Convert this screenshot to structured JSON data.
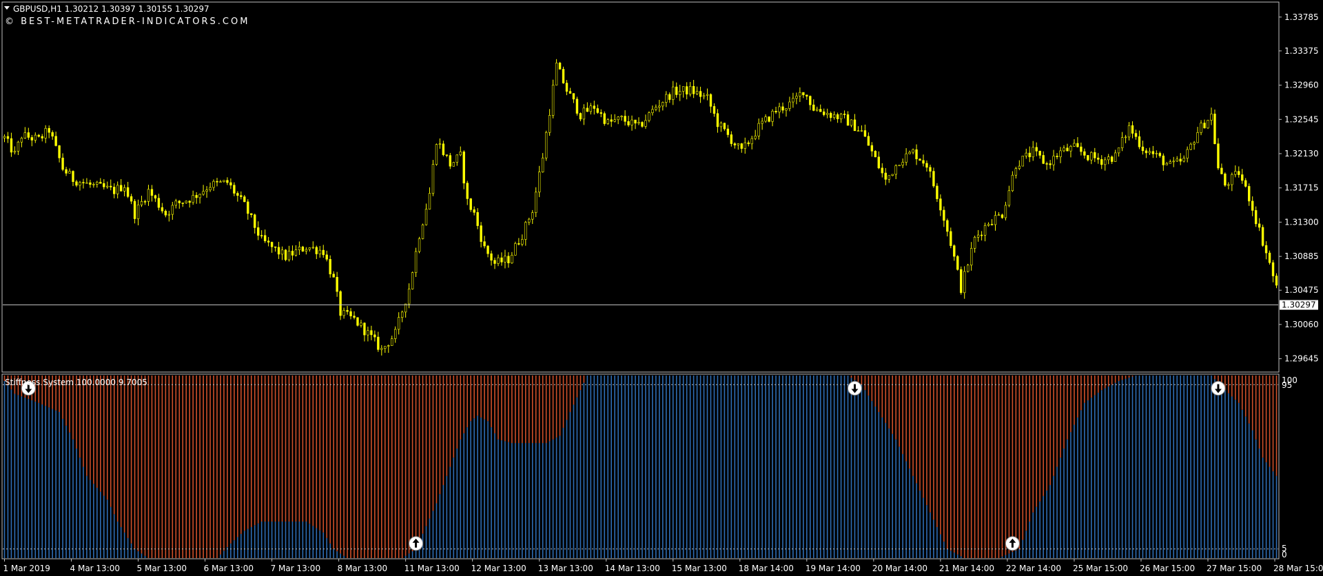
{
  "header": {
    "symbol_info": "GBPUSD,H1  1.30212 1.30397 1.30155 1.30297",
    "watermark": "© BEST-METATRADER-INDICATORS.COM"
  },
  "indicator": {
    "label": "Stiffness System 100.0000 9.7005",
    "level_high": "95",
    "level_100": "100",
    "level_low": "5",
    "level_0": "0"
  },
  "colors": {
    "background": "#000000",
    "candles": "#ffff00",
    "border": "#c0c0c0",
    "stiff_up": "#2e6db4",
    "stiff_down": "#d0502a",
    "arrow": "#ffffff"
  },
  "icons": {
    "dropdown": "triangle-down-icon",
    "arrow_up": "up-arrow-circle-icon",
    "arrow_down": "down-arrow-circle-icon"
  },
  "chart_data": {
    "type": "candlestick",
    "symbol": "GBPUSD",
    "timeframe": "H1",
    "current_price": "1.30297",
    "y_ticks": [
      "1.33785",
      "1.33375",
      "1.32960",
      "1.32545",
      "1.32130",
      "1.31715",
      "1.31300",
      "1.30885",
      "1.30475",
      "1.30060",
      "1.29645"
    ],
    "ylim": [
      1.295,
      1.3395
    ],
    "x_ticks": [
      "1 Mar 2019",
      "4 Mar 13:00",
      "5 Mar 13:00",
      "6 Mar 13:00",
      "7 Mar 13:00",
      "8 Mar 13:00",
      "11 Mar 13:00",
      "12 Mar 13:00",
      "13 Mar 13:00",
      "14 Mar 13:00",
      "15 Mar 13:00",
      "18 Mar 14:00",
      "19 Mar 14:00",
      "20 Mar 14:00",
      "21 Mar 14:00",
      "22 Mar 14:00",
      "25 Mar 15:00",
      "26 Mar 15:00",
      "27 Mar 15:00",
      "28 Mar 15:00"
    ],
    "price_path": [
      [
        0,
        1.3232
      ],
      [
        3,
        1.3212
      ],
      [
        5,
        1.3235
      ],
      [
        10,
        1.323
      ],
      [
        13,
        1.3242
      ],
      [
        17,
        1.3195
      ],
      [
        20,
        1.3182
      ],
      [
        25,
        1.3175
      ],
      [
        32,
        1.3168
      ],
      [
        35,
        1.3175
      ],
      [
        38,
        1.314
      ],
      [
        42,
        1.3168
      ],
      [
        47,
        1.314
      ],
      [
        50,
        1.3152
      ],
      [
        55,
        1.316
      ],
      [
        60,
        1.3175
      ],
      [
        65,
        1.3178
      ],
      [
        70,
        1.315
      ],
      [
        75,
        1.3108
      ],
      [
        82,
        1.3088
      ],
      [
        88,
        1.31
      ],
      [
        93,
        1.3095
      ],
      [
        96,
        1.306
      ],
      [
        98,
        1.302
      ],
      [
        102,
        1.3012
      ],
      [
        106,
        1.2995
      ],
      [
        110,
        1.2975
      ],
      [
        114,
        1.2995
      ],
      [
        118,
        1.305
      ],
      [
        121,
        1.3115
      ],
      [
        124,
        1.3165
      ],
      [
        126,
        1.323
      ],
      [
        130,
        1.32
      ],
      [
        133,
        1.321
      ],
      [
        135,
        1.3155
      ],
      [
        137,
        1.314
      ],
      [
        140,
        1.3098
      ],
      [
        143,
        1.308
      ],
      [
        147,
        1.3085
      ],
      [
        151,
        1.3115
      ],
      [
        154,
        1.3145
      ],
      [
        157,
        1.321
      ],
      [
        161,
        1.332
      ],
      [
        164,
        1.329
      ],
      [
        168,
        1.326
      ],
      [
        172,
        1.327
      ],
      [
        176,
        1.325
      ],
      [
        180,
        1.3255
      ],
      [
        185,
        1.3245
      ],
      [
        190,
        1.327
      ],
      [
        195,
        1.3288
      ],
      [
        200,
        1.329
      ],
      [
        205,
        1.328
      ],
      [
        208,
        1.325
      ],
      [
        212,
        1.323
      ],
      [
        215,
        1.3215
      ],
      [
        220,
        1.3245
      ],
      [
        225,
        1.3265
      ],
      [
        230,
        1.3275
      ],
      [
        233,
        1.329
      ],
      [
        236,
        1.3268
      ],
      [
        240,
        1.3262
      ],
      [
        245,
        1.3255
      ],
      [
        250,
        1.324
      ],
      [
        253,
        1.3215
      ],
      [
        257,
        1.318
      ],
      [
        261,
        1.3205
      ],
      [
        265,
        1.3215
      ],
      [
        269,
        1.32
      ],
      [
        273,
        1.315
      ],
      [
        276,
        1.3105
      ],
      [
        279,
        1.305
      ],
      [
        283,
        1.311
      ],
      [
        287,
        1.313
      ],
      [
        291,
        1.314
      ],
      [
        295,
        1.32
      ],
      [
        300,
        1.3215
      ],
      [
        304,
        1.32
      ],
      [
        308,
        1.3215
      ],
      [
        312,
        1.322
      ],
      [
        316,
        1.321
      ],
      [
        320,
        1.3205
      ],
      [
        324,
        1.321
      ],
      [
        328,
        1.3245
      ],
      [
        332,
        1.322
      ],
      [
        336,
        1.321
      ],
      [
        340,
        1.3198
      ],
      [
        344,
        1.3205
      ],
      [
        348,
        1.324
      ],
      [
        352,
        1.326
      ],
      [
        354,
        1.3195
      ],
      [
        356,
        1.3175
      ],
      [
        360,
        1.319
      ],
      [
        363,
        1.316
      ],
      [
        366,
        1.312
      ],
      [
        369,
        1.308
      ],
      [
        371,
        1.305
      ]
    ],
    "stiffness": {
      "scale": [
        0,
        100
      ],
      "levels": [
        5,
        95
      ],
      "label": "Stiffness System 100.0000 9.7005",
      "up_path": [
        [
          0,
          97
        ],
        [
          3,
          90
        ],
        [
          10,
          85
        ],
        [
          16,
          80
        ],
        [
          20,
          65
        ],
        [
          24,
          45
        ],
        [
          30,
          32
        ],
        [
          33,
          20
        ],
        [
          38,
          5
        ],
        [
          42,
          0
        ],
        [
          62,
          0
        ],
        [
          66,
          8
        ],
        [
          70,
          15
        ],
        [
          75,
          20
        ],
        [
          88,
          20
        ],
        [
          93,
          14
        ],
        [
          96,
          5
        ],
        [
          100,
          0
        ],
        [
          116,
          0
        ],
        [
          120,
          5
        ],
        [
          126,
          30
        ],
        [
          133,
          65
        ],
        [
          136,
          75
        ],
        [
          138,
          78
        ],
        [
          141,
          75
        ],
        [
          144,
          65
        ],
        [
          148,
          63
        ],
        [
          158,
          63
        ],
        [
          162,
          67
        ],
        [
          165,
          80
        ],
        [
          170,
          100
        ],
        [
          246,
          100
        ],
        [
          250,
          95
        ],
        [
          255,
          80
        ],
        [
          260,
          65
        ],
        [
          265,
          45
        ],
        [
          270,
          25
        ],
        [
          275,
          5
        ],
        [
          280,
          0
        ],
        [
          290,
          0
        ],
        [
          296,
          5
        ],
        [
          300,
          25
        ],
        [
          305,
          40
        ],
        [
          310,
          65
        ],
        [
          315,
          85
        ],
        [
          320,
          92
        ],
        [
          325,
          97
        ],
        [
          330,
          100
        ],
        [
          352,
          100
        ],
        [
          356,
          92
        ],
        [
          360,
          85
        ],
        [
          364,
          70
        ],
        [
          367,
          55
        ],
        [
          371,
          45
        ]
      ],
      "signals": [
        {
          "bar": 7,
          "direction": "down",
          "value": 93
        },
        {
          "bar": 120,
          "direction": "up",
          "value": 8
        },
        {
          "bar": 248,
          "direction": "down",
          "value": 93
        },
        {
          "bar": 294,
          "direction": "up",
          "value": 8
        },
        {
          "bar": 354,
          "direction": "down",
          "value": 93
        }
      ]
    }
  }
}
